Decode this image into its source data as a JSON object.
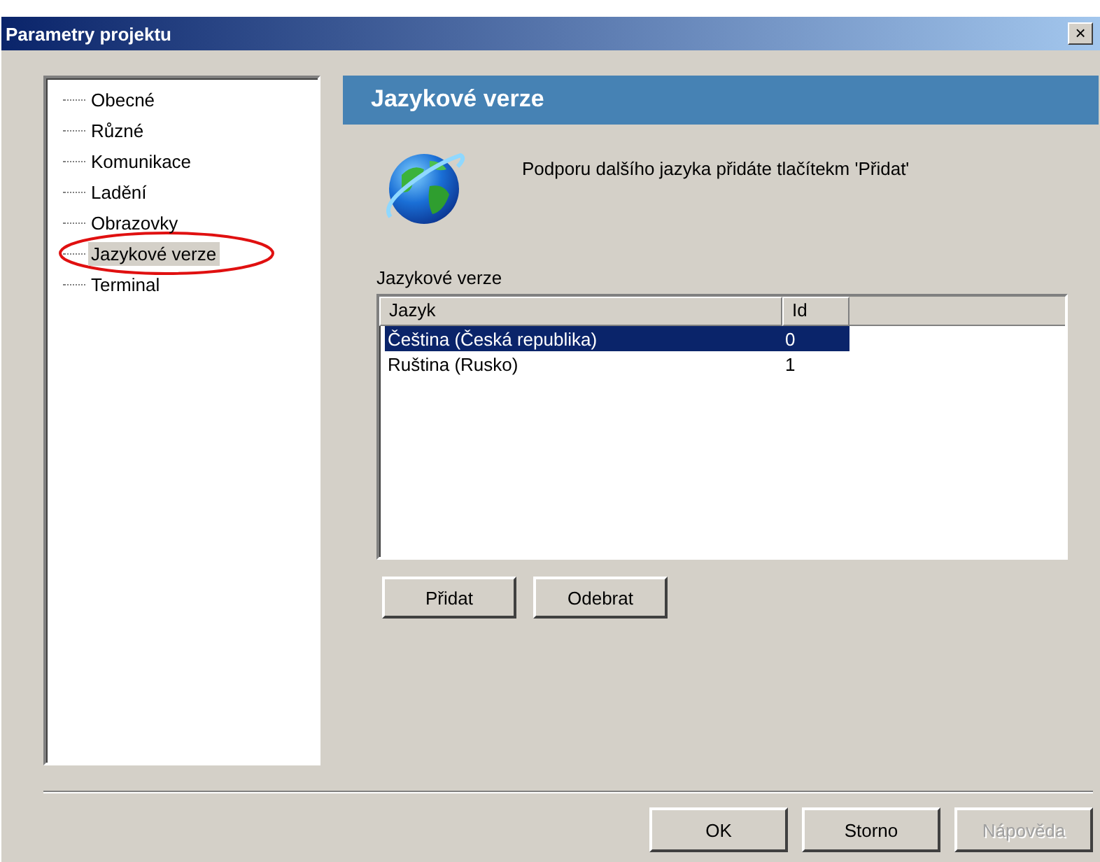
{
  "window": {
    "title": "Parametry projektu",
    "close_label": "×"
  },
  "tree": {
    "items": [
      {
        "label": "Obecné",
        "selected": false
      },
      {
        "label": "Různé",
        "selected": false
      },
      {
        "label": "Komunikace",
        "selected": false
      },
      {
        "label": "Ladění",
        "selected": false
      },
      {
        "label": "Obrazovky",
        "selected": false
      },
      {
        "label": "Jazykové verze",
        "selected": true
      },
      {
        "label": "Terminal",
        "selected": false
      }
    ]
  },
  "annotation": {
    "kind": "ellipse"
  },
  "page": {
    "header": "Jazykové verze",
    "hint": "Podporu dalšího jazyka přidáte tlačítekm 'Přidat'",
    "list_label": "Jazykové verze",
    "table": {
      "columns": [
        "Jazyk",
        "Id"
      ],
      "rows": [
        {
          "cells": [
            "Čeština (Česká republika)",
            "0"
          ],
          "selected": true
        },
        {
          "cells": [
            "Ruština (Rusko)",
            "1"
          ],
          "selected": false
        }
      ]
    },
    "buttons": [
      {
        "label": "Přidat",
        "disabled": false
      },
      {
        "label": "Odebrat",
        "disabled": false
      }
    ]
  },
  "dialog_buttons": [
    {
      "label": "OK",
      "disabled": false
    },
    {
      "label": "Storno",
      "disabled": false
    },
    {
      "label": "Nápověda",
      "disabled": true
    }
  ]
}
